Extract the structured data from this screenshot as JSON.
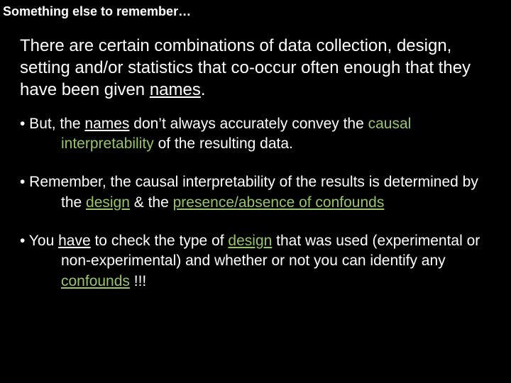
{
  "title": "Something else to remember…",
  "intro": {
    "a": "There are certain combinations of data collection, design, setting and/or statistics that co-occur often enough that they have been given ",
    "names": "names",
    "b": "."
  },
  "bullets": [
    {
      "mark": "• But, the ",
      "names": "names",
      "t1": " don’t always accurately convey the ",
      "g1": "causal interpretability",
      "t2": " of the resulting data."
    },
    {
      "mark": "• Remember, the causal interpretability of the results is determined by the ",
      "g1": "design",
      "t1": " & the ",
      "g2": "presence/absence of confounds",
      "t2": ""
    },
    {
      "mark": "• You ",
      "u1": "have",
      "t1": " to check the type of ",
      "g1": "design",
      "t2": " that was used (experimental or non-experimental) and whether or not you can identify any ",
      "g2": "confounds",
      "t3": " !!!"
    }
  ]
}
